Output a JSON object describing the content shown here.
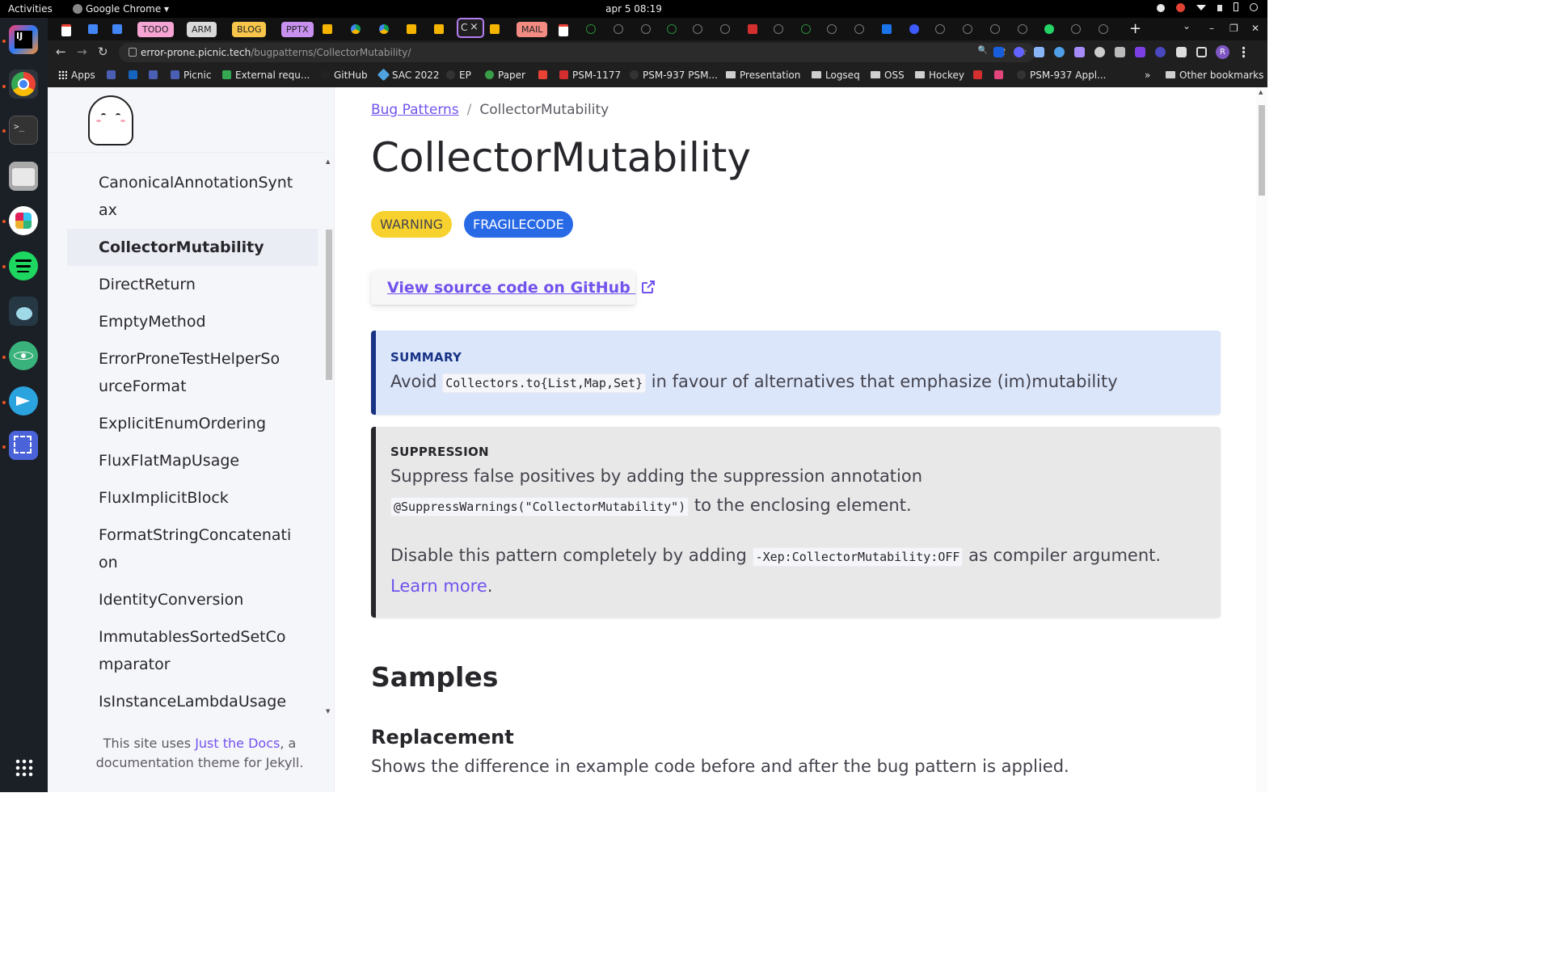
{
  "system": {
    "activities_label": "Activities",
    "app_name": "Google Chrome",
    "app_menu_glyph": "▾",
    "clock": "apr 5  08:19",
    "tray_icons": [
      "slack-tray-icon",
      "chrome-tray-icon",
      "wifi-icon",
      "volume-icon",
      "battery-icon",
      "power-icon"
    ]
  },
  "dock": {
    "apps": [
      "intellij-icon",
      "chrome-icon",
      "terminal-icon",
      "files-icon",
      "slack-icon",
      "spotify-icon",
      "gnome-icon",
      "atom-icon",
      "telegram-icon",
      "screenshot-icon"
    ],
    "show_apps_icon": "app-grid-icon"
  },
  "tabs": {
    "items": [
      {
        "label": "TODO",
        "color": "#f5a4d4"
      },
      {
        "label": "ARM",
        "color": "#d9d9d9"
      },
      {
        "label": "BLOG",
        "color": "#f6c54a"
      },
      {
        "label": "PPTX",
        "color": "#c891f0"
      },
      {
        "label": "MAIL",
        "color": "#f28b82"
      }
    ],
    "active_label": "C",
    "active_close": "×",
    "new_tab_glyph": "+",
    "tab_search_glyph": "⌄",
    "window_controls": [
      "–",
      "❐",
      "✕"
    ]
  },
  "nav": {
    "back_glyph": "←",
    "forward_glyph": "→",
    "reload_glyph": "↻",
    "url_host": "error-prone.picnic.tech",
    "url_path": "/bugpatterns/CollectorMutability/",
    "zoom_glyph": "🔍",
    "share_glyph": "⇪",
    "star_glyph": "☆",
    "profile_initial": "R"
  },
  "bookmarks": {
    "apps_label": "Apps",
    "items": [
      {
        "label": "",
        "icon": "#4a5eb3"
      },
      {
        "label": "",
        "icon": "#1565c0"
      },
      {
        "label": "",
        "icon": "#4a5eb3"
      },
      {
        "label": "Picnic",
        "icon": "#4a5eb3"
      },
      {
        "label": "External requ...",
        "icon": "#34a853"
      },
      {
        "label": "GitHub",
        "icon": "#222"
      },
      {
        "label": "SAC 2022",
        "icon": "#4fa3e0"
      },
      {
        "label": "EP",
        "icon": "#333"
      },
      {
        "label": "Paper",
        "icon": "#3a9d47"
      },
      {
        "label": "",
        "icon": "#ea4335"
      },
      {
        "label": "PSM-1177",
        "icon": "#d32f2f"
      },
      {
        "label": "PSM-937 PSM...",
        "icon": "#333"
      }
    ],
    "folders": [
      "Presentation",
      "Logseq",
      "OSS",
      "Hockey"
    ],
    "tail_items": [
      {
        "label": "",
        "icon": "#d32f2f"
      },
      {
        "label": "",
        "icon": "#e0457b"
      },
      {
        "label": "PSM-937 Appl...",
        "icon": "#333"
      }
    ],
    "overflow_glyph": "»",
    "other_label": "Other bookmarks"
  },
  "sidebar": {
    "items": [
      {
        "label": "CanonicalAnnotationSyntax",
        "lines": [
          "CanonicalAnnotationSynt",
          "ax"
        ]
      },
      {
        "label": "CollectorMutability",
        "lines": [
          "CollectorMutability"
        ],
        "active": true
      },
      {
        "label": "DirectReturn",
        "lines": [
          "DirectReturn"
        ]
      },
      {
        "label": "EmptyMethod",
        "lines": [
          "EmptyMethod"
        ]
      },
      {
        "label": "ErrorProneTestHelperSourceFormat",
        "lines": [
          "ErrorProneTestHelperSo",
          "urceFormat"
        ]
      },
      {
        "label": "ExplicitEnumOrdering",
        "lines": [
          "ExplicitEnumOrdering"
        ]
      },
      {
        "label": "FluxFlatMapUsage",
        "lines": [
          "FluxFlatMapUsage"
        ]
      },
      {
        "label": "FluxImplicitBlock",
        "lines": [
          "FluxImplicitBlock"
        ]
      },
      {
        "label": "FormatStringConcatenation",
        "lines": [
          "FormatStringConcatenati",
          "on"
        ]
      },
      {
        "label": "IdentityConversion",
        "lines": [
          "IdentityConversion"
        ]
      },
      {
        "label": "ImmutablesSortedSetComparator",
        "lines": [
          "ImmutablesSortedSetCo",
          "mparator"
        ]
      },
      {
        "label": "IsInstanceLambdaUsage",
        "lines": [
          "IsInstanceLambdaUsage"
        ]
      }
    ],
    "footer_prefix": "This site uses ",
    "footer_link": "Just the Docs",
    "footer_suffix": ", a documentation theme for Jekyll."
  },
  "main": {
    "breadcrumb_parent": "Bug Patterns",
    "breadcrumb_sep": "/",
    "breadcrumb_current": "CollectorMutability",
    "title": "CollectorMutability",
    "badges": [
      {
        "label": "WARNING",
        "bg": "#f7d12e",
        "fg": "#44434d"
      },
      {
        "label": "FRAGILECODE",
        "bg": "#2869e6",
        "fg": "#ffffff"
      }
    ],
    "github_button": "View source code on GitHub",
    "summary": {
      "title": "SUMMARY",
      "before": "Avoid",
      "code": "Collectors.to{List,Map,Set}",
      "after": "in favour of alternatives that emphasize (im)mutability",
      "accent": "#183385",
      "bg": "#dbe6fb"
    },
    "suppression": {
      "title": "SUPPRESSION",
      "p1_before": "Suppress false positives by adding the suppression annotation",
      "p1_code": "@SuppressWarnings(\"CollectorMutability\")",
      "p1_after": "to the enclosing element.",
      "p2_before": "Disable this pattern completely by adding",
      "p2_code": "-Xep:CollectorMutability:OFF",
      "p2_after": "as compiler argument.",
      "learn_more": "Learn more",
      "accent": "#27262b",
      "bg": "#e8e8e8"
    },
    "samples_heading": "Samples",
    "replacement_heading": "Replacement",
    "replacement_desc": "Shows the difference in example code before and after the bug pattern is applied."
  }
}
